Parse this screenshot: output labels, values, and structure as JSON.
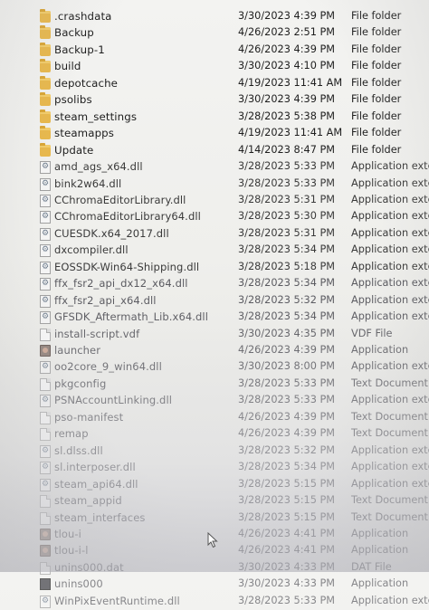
{
  "files": [
    {
      "icon": "folder-icon",
      "name": ".crashdata",
      "date": "3/30/2023 4:39 PM",
      "type": "File folder"
    },
    {
      "icon": "folder-icon",
      "name": "Backup",
      "date": "4/26/2023 2:51 PM",
      "type": "File folder"
    },
    {
      "icon": "folder-icon",
      "name": "Backup-1",
      "date": "4/26/2023 4:39 PM",
      "type": "File folder"
    },
    {
      "icon": "folder-icon",
      "name": "build",
      "date": "3/30/2023 4:10 PM",
      "type": "File folder"
    },
    {
      "icon": "folder-icon",
      "name": "depotcache",
      "date": "4/19/2023 11:41 AM",
      "type": "File folder"
    },
    {
      "icon": "folder-icon",
      "name": "psolibs",
      "date": "3/30/2023 4:39 PM",
      "type": "File folder"
    },
    {
      "icon": "folder-icon",
      "name": "steam_settings",
      "date": "3/28/2023 5:38 PM",
      "type": "File folder"
    },
    {
      "icon": "folder-icon",
      "name": "steamapps",
      "date": "4/19/2023 11:41 AM",
      "type": "File folder"
    },
    {
      "icon": "folder-icon",
      "name": "Update",
      "date": "4/14/2023 8:47 PM",
      "type": "File folder"
    },
    {
      "icon": "dll-icon",
      "name": "amd_ags_x64.dll",
      "date": "3/28/2023 5:33 PM",
      "type": "Application exten..."
    },
    {
      "icon": "dll-icon",
      "name": "bink2w64.dll",
      "date": "3/28/2023 5:33 PM",
      "type": "Application exten..."
    },
    {
      "icon": "dll-icon",
      "name": "CChromaEditorLibrary.dll",
      "date": "3/28/2023 5:31 PM",
      "type": "Application exten..."
    },
    {
      "icon": "dll-icon",
      "name": "CChromaEditorLibrary64.dll",
      "date": "3/28/2023 5:30 PM",
      "type": "Application exten..."
    },
    {
      "icon": "dll-icon",
      "name": "CUESDK.x64_2017.dll",
      "date": "3/28/2023 5:31 PM",
      "type": "Application exten..."
    },
    {
      "icon": "dll-icon",
      "name": "dxcompiler.dll",
      "date": "3/28/2023 5:34 PM",
      "type": "Application exten..."
    },
    {
      "icon": "dll-icon",
      "name": "EOSSDK-Win64-Shipping.dll",
      "date": "3/28/2023 5:18 PM",
      "type": "Application exten..."
    },
    {
      "icon": "dll-icon",
      "name": "ffx_fsr2_api_dx12_x64.dll",
      "date": "3/28/2023 5:34 PM",
      "type": "Application exten..."
    },
    {
      "icon": "dll-icon",
      "name": "ffx_fsr2_api_x64.dll",
      "date": "3/28/2023 5:32 PM",
      "type": "Application exten..."
    },
    {
      "icon": "dll-icon",
      "name": "GFSDK_Aftermath_Lib.x64.dll",
      "date": "3/28/2023 5:34 PM",
      "type": "Application exten..."
    },
    {
      "icon": "file-icon",
      "name": "install-script.vdf",
      "date": "3/30/2023 4:35 PM",
      "type": "VDF File"
    },
    {
      "icon": "app-icon",
      "name": "launcher",
      "date": "4/26/2023 4:39 PM",
      "type": "Application"
    },
    {
      "icon": "dll-icon",
      "name": "oo2core_9_win64.dll",
      "date": "3/30/2023 8:00 PM",
      "type": "Application exten..."
    },
    {
      "icon": "file-icon",
      "name": "pkgconfig",
      "date": "3/28/2023 5:33 PM",
      "type": "Text Document"
    },
    {
      "icon": "dll-icon",
      "name": "PSNAccountLinking.dll",
      "date": "3/28/2023 5:33 PM",
      "type": "Application exten..."
    },
    {
      "icon": "file-icon",
      "name": "pso-manifest",
      "date": "4/26/2023 4:39 PM",
      "type": "Text Document"
    },
    {
      "icon": "file-icon",
      "name": "remap",
      "date": "4/26/2023 4:39 PM",
      "type": "Text Document"
    },
    {
      "icon": "dll-icon",
      "name": "sl.dlss.dll",
      "date": "3/28/2023 5:32 PM",
      "type": "Application exten..."
    },
    {
      "icon": "dll-icon",
      "name": "sl.interposer.dll",
      "date": "3/28/2023 5:34 PM",
      "type": "Application exten..."
    },
    {
      "icon": "dll-icon",
      "name": "steam_api64.dll",
      "date": "3/28/2023 5:15 PM",
      "type": "Application exten..."
    },
    {
      "icon": "file-icon",
      "name": "steam_appid",
      "date": "3/28/2023 5:15 PM",
      "type": "Text Document"
    },
    {
      "icon": "file-icon",
      "name": "steam_interfaces",
      "date": "3/28/2023 5:15 PM",
      "type": "Text Document"
    },
    {
      "icon": "app-icon",
      "name": "tlou-i",
      "date": "4/26/2023 4:41 PM",
      "type": "Application"
    },
    {
      "icon": "app-icon",
      "name": "tlou-i-l",
      "date": "4/26/2023 4:41 PM",
      "type": "Application"
    },
    {
      "icon": "file-icon",
      "name": "unins000.dat",
      "date": "3/30/2023 4:33 PM",
      "type": "DAT File"
    },
    {
      "icon": "uninstaller-icon",
      "name": "unins000",
      "date": "3/30/2023 4:33 PM",
      "type": "Application"
    },
    {
      "icon": "dll-icon",
      "name": "WinPixEventRuntime.dll",
      "date": "3/28/2023 5:33 PM",
      "type": "Application exten..."
    }
  ]
}
